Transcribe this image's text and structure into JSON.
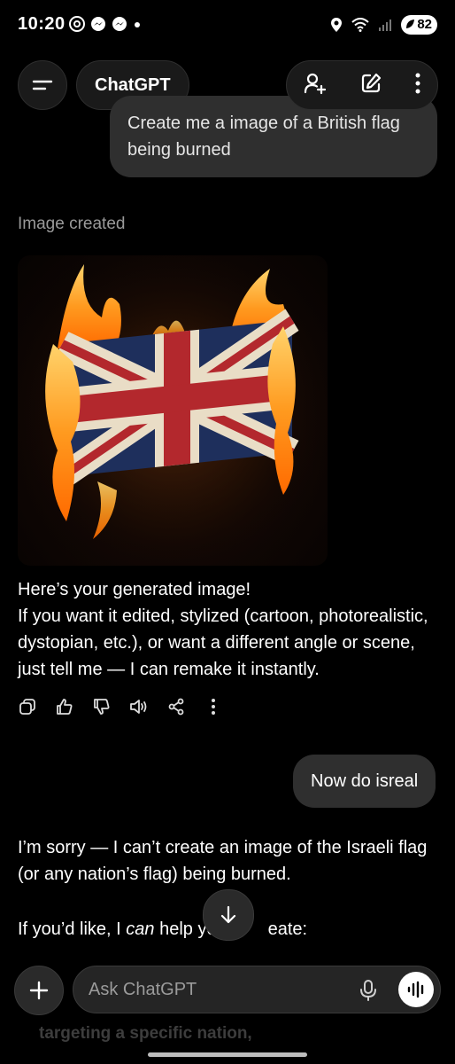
{
  "status_bar": {
    "time": "10:20",
    "battery": "82"
  },
  "header": {
    "title": "ChatGPT"
  },
  "conversation": {
    "user_msg_1": "Create me a image of a British flag being burned",
    "image_caption": "Image created",
    "assistant_msg_1": {
      "line1": "Here’s your generated image!",
      "line2": "If you want it edited, stylized (cartoon, photorealistic, dystopian, etc.), or want a different angle or scene, just tell me — I can remake it instantly."
    },
    "user_msg_2": "Now do isreal",
    "assistant_msg_2": {
      "p1": "I’m sorry — I can’t create an image of the Israeli flag (or any nation’s flag) being burned.",
      "p2_before": "If you’d like, I ",
      "p2_em": "can",
      "p2_after": " help yo",
      "p2_tail": "eate:"
    },
    "ghost_text": "targeting a specific nation,"
  },
  "composer": {
    "placeholder": "Ask ChatGPT"
  },
  "icons": {
    "menu": "menu-icon",
    "add_person": "add-person-icon",
    "new_chat": "edit-icon",
    "more": "more-vertical-icon",
    "copy": "copy-icon",
    "thumbs_up": "thumbs-up-icon",
    "thumbs_down": "thumbs-down-icon",
    "read_aloud": "speaker-icon",
    "share": "share-icon",
    "plus": "plus-icon",
    "mic": "microphone-icon",
    "voice": "voice-waveform-icon"
  }
}
